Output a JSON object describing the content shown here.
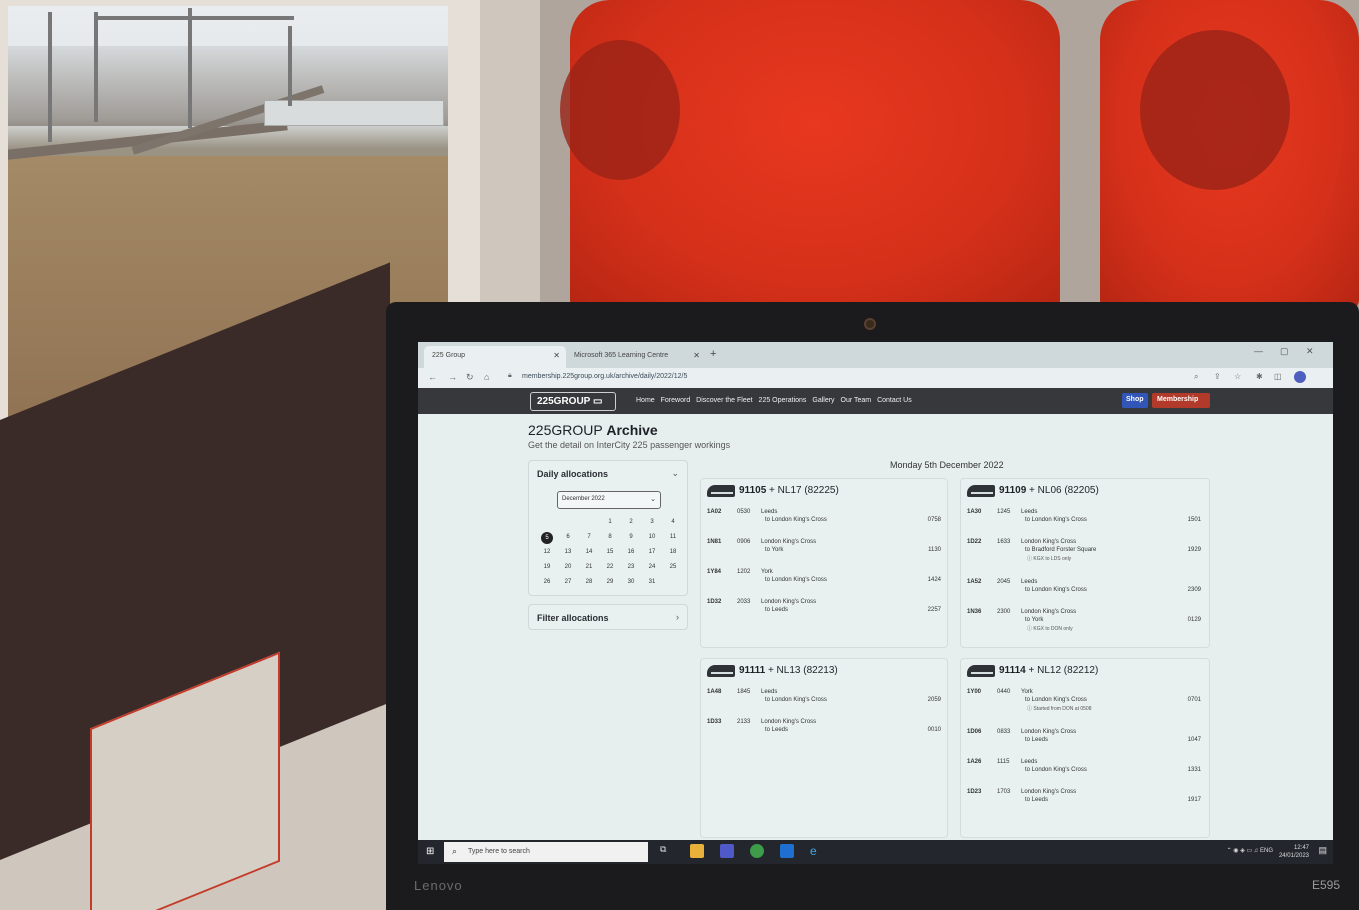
{
  "browser": {
    "tabs": [
      {
        "label": "225 Group",
        "active": true
      },
      {
        "label": "Microsoft 365 Learning Centre",
        "active": false
      }
    ],
    "url": "membership.225group.org.uk/archive/daily/2022/12/5"
  },
  "site": {
    "logo": "225GROUP",
    "nav": [
      "Home",
      "Foreword",
      "Discover the Fleet",
      "225 Operations",
      "Gallery",
      "Our Team",
      "Contact Us"
    ],
    "shop_label": "Shop",
    "membership_label": "Membership"
  },
  "page": {
    "title_prefix": "225GROUP",
    "title_bold": "Archive",
    "subtitle": "Get the detail on InterCity 225 passenger workings",
    "date_heading": "Monday 5th December 2022"
  },
  "sidebar": {
    "daily_label": "Daily allocations",
    "month_value": "December 2022",
    "calendar_rows": [
      [
        "",
        "",
        "",
        "1",
        "2",
        "3",
        "4"
      ],
      [
        "5",
        "6",
        "7",
        "8",
        "9",
        "10",
        "11"
      ],
      [
        "12",
        "13",
        "14",
        "15",
        "16",
        "17",
        "18"
      ],
      [
        "19",
        "20",
        "21",
        "22",
        "23",
        "24",
        "25"
      ],
      [
        "26",
        "27",
        "28",
        "29",
        "30",
        "31",
        ""
      ]
    ],
    "selected_day": "5",
    "filter_label": "Filter allocations"
  },
  "cards": [
    {
      "loco": "91105",
      "set": "+ NL17 (82225)",
      "services": [
        {
          "headcode": "1A02",
          "dep": "0530",
          "from": "Leeds",
          "to": "to London King's Cross",
          "arr": "0758",
          "note": ""
        },
        {
          "headcode": "1N81",
          "dep": "0906",
          "from": "London King's Cross",
          "to": "to York",
          "arr": "1130",
          "note": ""
        },
        {
          "headcode": "1Y84",
          "dep": "1202",
          "from": "York",
          "to": "to London King's Cross",
          "arr": "1424",
          "note": ""
        },
        {
          "headcode": "1D32",
          "dep": "2033",
          "from": "London King's Cross",
          "to": "to Leeds",
          "arr": "2257",
          "note": ""
        }
      ]
    },
    {
      "loco": "91109",
      "set": "+ NL06 (82205)",
      "services": [
        {
          "headcode": "1A30",
          "dep": "1245",
          "from": "Leeds",
          "to": "to London King's Cross",
          "arr": "1501",
          "note": ""
        },
        {
          "headcode": "1D22",
          "dep": "1633",
          "from": "London King's Cross",
          "to": "to Bradford Forster Square",
          "arr": "1929",
          "note": "ⓘ KGX to LDS only"
        },
        {
          "headcode": "1A52",
          "dep": "2045",
          "from": "Leeds",
          "to": "to London King's Cross",
          "arr": "2309",
          "note": ""
        },
        {
          "headcode": "1N36",
          "dep": "2300",
          "from": "London King's Cross",
          "to": "to York",
          "arr": "0129",
          "note": "ⓘ KGX to DON only"
        }
      ]
    },
    {
      "loco": "91111",
      "set": "+ NL13 (82213)",
      "services": [
        {
          "headcode": "1A48",
          "dep": "1845",
          "from": "Leeds",
          "to": "to London King's Cross",
          "arr": "2059",
          "note": ""
        },
        {
          "headcode": "1D33",
          "dep": "2133",
          "from": "London King's Cross",
          "to": "to Leeds",
          "arr": "0010",
          "note": ""
        }
      ]
    },
    {
      "loco": "91114",
      "set": "+ NL12 (82212)",
      "services": [
        {
          "headcode": "1Y00",
          "dep": "0440",
          "from": "York",
          "to": "to London King's Cross",
          "arr": "0701",
          "note": "ⓘ Started from DON at 0508"
        },
        {
          "headcode": "1D06",
          "dep": "0833",
          "from": "London King's Cross",
          "to": "to Leeds",
          "arr": "1047",
          "note": ""
        },
        {
          "headcode": "1A26",
          "dep": "1115",
          "from": "Leeds",
          "to": "to London King's Cross",
          "arr": "1331",
          "note": ""
        },
        {
          "headcode": "1D23",
          "dep": "1703",
          "from": "London King's Cross",
          "to": "to Leeds",
          "arr": "1917",
          "note": ""
        }
      ]
    }
  ],
  "taskbar": {
    "search_placeholder": "Type here to search",
    "lang": "ENG",
    "time": "12:47",
    "date": "24/01/2023"
  },
  "laptop": {
    "brand": "Lenovo",
    "model": "E595"
  },
  "colors": {
    "seat_red": "#d5301a",
    "nav_dark": "#36383c",
    "shop_blue": "#3156b8",
    "membership_red": "#b23a2a"
  }
}
